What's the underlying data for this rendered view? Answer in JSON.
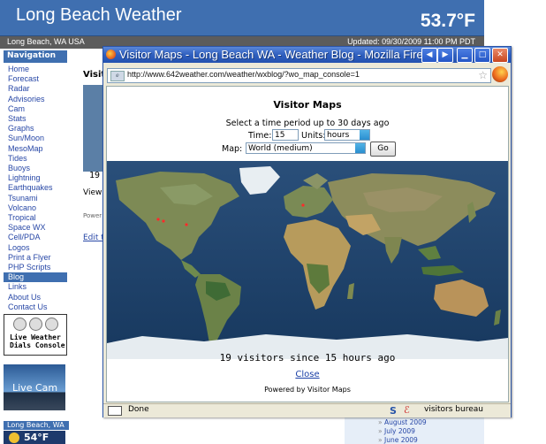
{
  "site": {
    "title": "Long Beach Weather",
    "temperature": "53.7°F",
    "location": "Long Beach, WA USA",
    "updated": "Updated: 09/30/2009 11:00 PM PDT"
  },
  "sidebar": {
    "heading": "Navigation",
    "items": [
      {
        "label": "Home"
      },
      {
        "label": "Forecast"
      },
      {
        "label": "Radar"
      },
      {
        "label": "Advisories"
      },
      {
        "label": "Cam"
      },
      {
        "label": "Stats"
      },
      {
        "label": "Graphs"
      },
      {
        "label": "Sun/Moon"
      },
      {
        "label": "MesoMap"
      },
      {
        "label": "Tides"
      },
      {
        "label": "Buoys"
      },
      {
        "label": "Lightning"
      },
      {
        "label": "Earthquakes"
      },
      {
        "label": "Tsunami"
      },
      {
        "label": "Volcano"
      },
      {
        "label": "Tropical"
      },
      {
        "label": "Space WX"
      },
      {
        "label": "Cell/PDA"
      },
      {
        "label": "Logos"
      },
      {
        "label": "Print a Flyer"
      },
      {
        "label": "PHP Scripts"
      },
      {
        "label": "Blog",
        "active": true
      },
      {
        "label": "Links"
      },
      {
        "label": "About Us"
      },
      {
        "label": "Contact Us"
      }
    ],
    "dials_label_line1": "Live Weather",
    "dials_label_line2": "Dials Console",
    "livecam_label": "Live Cam",
    "widget_title": "Long Beach, WA",
    "widget_temp": "54°F"
  },
  "background_blog": {
    "visit_label": "Visit",
    "count_fragment": "19",
    "view_label": "View",
    "powered_fragment": "Power",
    "edit_label": "Edit t",
    "archive": [
      "August 2009",
      "July 2009",
      "June 2009"
    ]
  },
  "popup": {
    "window_title": "Visitor Maps - Long Beach WA - Weather Blog - Mozilla Firefox",
    "url": "http://www.642weather.com/weather/wxblog/?wo_map_console=1",
    "heading": "Visitor Maps",
    "select_text": "Select a time period up to 30 days ago",
    "time_label": "Time:",
    "time_value": "15",
    "units_label": "Units:",
    "units_value": "hours",
    "map_label": "Map:",
    "map_value": "World (medium)",
    "go_label": "Go",
    "visitor_summary": "19 visitors since 15 hours ago",
    "close_label": "Close",
    "powered_by": "Powered by Visitor Maps",
    "status_text": "Done",
    "status_right_label": "visitors bureau",
    "icons": {
      "title": "firefox-icon",
      "back": "triangle-left-icon",
      "forward": "triangle-right-icon",
      "minimize": "minimize-icon",
      "maximize": "maximize-icon",
      "close": "close-icon",
      "bookmark": "star-icon"
    },
    "colors": {
      "titlebar": "#2f5fbf",
      "ocean": "#1d3f66",
      "land": "#7a8c58"
    }
  }
}
